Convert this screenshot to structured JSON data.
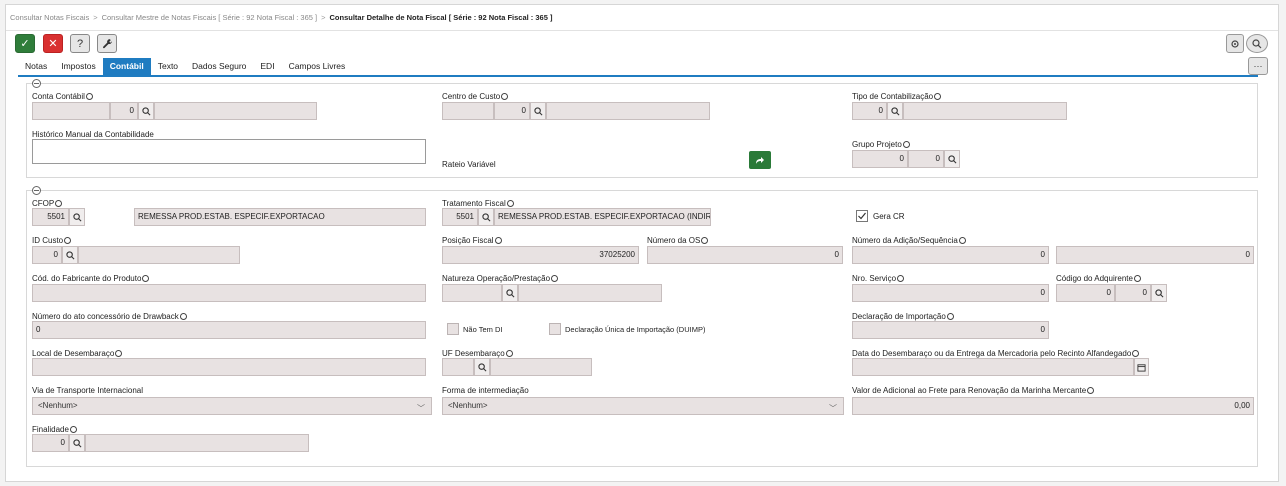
{
  "breadcrumb": {
    "items": [
      "Consultar Notas Fiscais",
      "Consultar Mestre de Notas Fiscais [ Série : 92 Nota Fiscal : 365 ]"
    ],
    "current": "Consultar Detalhe de Nota Fiscal [ Série : 92 Nota Fiscal : 365 ]",
    "separator": ">"
  },
  "toolbar": {
    "confirm": "✓",
    "cancel": "✕",
    "help": "?",
    "tools": "wrench-icon",
    "more": "···"
  },
  "tabs": [
    "Notas",
    "Impostos",
    "Contábil",
    "Texto",
    "Dados Seguro",
    "EDI",
    "Campos Livres"
  ],
  "active_tab": "Contábil",
  "contabil": {
    "conta_contabil": {
      "label": "Conta Contábil",
      "code": "",
      "num": "0",
      "desc": ""
    },
    "centro_custo": {
      "label": "Centro de Custo",
      "code": "",
      "num": "0",
      "desc": ""
    },
    "tipo_contab": {
      "label": "Tipo de Contabilização",
      "num": "0",
      "desc": ""
    },
    "historico": {
      "label": "Histórico Manual da Contabilidade",
      "value": ""
    },
    "rateio": {
      "label": "Rateio Variável"
    },
    "grupo_projeto": {
      "label": "Grupo Projeto",
      "v1": "0",
      "v2": "0"
    }
  },
  "fiscal": {
    "cfop": {
      "label": "CFOP",
      "code": "5501",
      "desc": "REMESSA PROD.ESTAB. ESPECIF.EXPORTACAO"
    },
    "tratamento": {
      "label": "Tratamento Fiscal",
      "code": "5501",
      "desc": "REMESSA PROD.ESTAB. ESPECIF.EXPORTACAO (INDIRETA)"
    },
    "gera_cr": {
      "label": "Gera CR",
      "checked": true
    },
    "id_custo": {
      "label": "ID Custo",
      "num": "0",
      "desc": ""
    },
    "posicao_fiscal": {
      "label": "Posição Fiscal",
      "value": "37025200"
    },
    "numero_os": {
      "label": "Número da OS",
      "value": "0"
    },
    "num_adicao": {
      "label": "Número da Adição/Sequência",
      "v1": "0",
      "v2": "0"
    },
    "cod_fabricante": {
      "label": "Cód. do Fabricante do Produto",
      "value": ""
    },
    "natureza_op": {
      "label": "Natureza Operação/Prestação",
      "code": "",
      "desc": ""
    },
    "nro_servico": {
      "label": "Nro. Serviço",
      "value": "0"
    },
    "cod_adquirente": {
      "label": "Código do Adquirente",
      "v1": "0",
      "v2": "0"
    },
    "drawback": {
      "label": "Número do ato concessório de Drawback",
      "value": "0"
    },
    "nao_tem_di": {
      "label": "Não Tem DI",
      "checked": false
    },
    "duimp": {
      "label": "Declaração Única de Importação (DUIMP)",
      "checked": false
    },
    "decl_importacao": {
      "label": "Declaração de Importação",
      "value": "0"
    },
    "local_desemb": {
      "label": "Local de Desembaraço",
      "value": ""
    },
    "uf_desemb": {
      "label": "UF Desembaraço",
      "code": "",
      "desc": ""
    },
    "data_desemb": {
      "label": "Data do Desembaraço ou da Entrega da Mercadoria pelo Recinto Alfandegado",
      "value": ""
    },
    "via_transporte": {
      "label": "Via de Transporte Internacional",
      "value": "<Nenhum>"
    },
    "forma_interm": {
      "label": "Forma de intermediação",
      "value": "<Nenhum>"
    },
    "valor_afrmm": {
      "label": "Valor de Adicional ao Frete para Renovação da Marinha Mercante",
      "value": "0,00"
    },
    "finalidade": {
      "label": "Finalidade",
      "num": "0",
      "desc": ""
    }
  }
}
